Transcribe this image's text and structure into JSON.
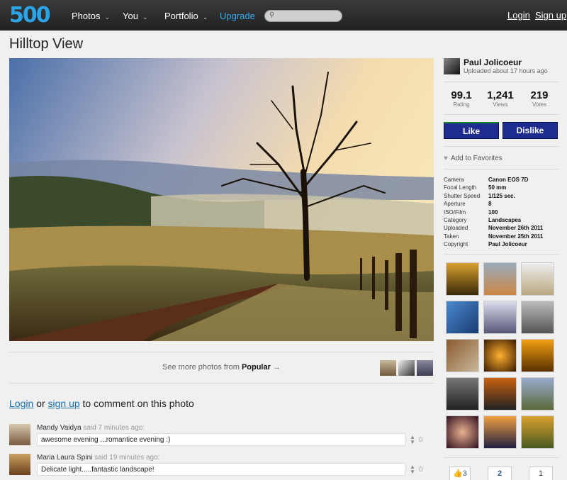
{
  "app": {
    "logo": "500"
  },
  "nav": {
    "photos": "Photos",
    "you": "You",
    "portfolio": "Portfolio",
    "upgrade": "Upgrade",
    "chevron": "⌄",
    "login": "Login",
    "signup": "Sign up"
  },
  "search": {
    "placeholder": "",
    "icon": "search-icon"
  },
  "photo": {
    "title": "Hilltop View"
  },
  "seemore": {
    "prefix": "See more photos from ",
    "category": "Popular",
    "arrow": "→"
  },
  "comment_prompt": {
    "login": "Login",
    "or": " or ",
    "signup": "sign up",
    "suffix": " to comment on this photo"
  },
  "comments": [
    {
      "author": "Mandy Vaidya",
      "when": " said 7 minutes ago:",
      "text": "awesome evening ...romantice evening :)",
      "votes": "0"
    },
    {
      "author": "Maria Laura Spini",
      "when": " said 19 minutes ago:",
      "text": "Delicate light.....fantastic landscape!",
      "votes": "0"
    }
  ],
  "owner": {
    "name": "Paul Jolicoeur",
    "uploaded": "Uploaded about 17 hours ago"
  },
  "stats": [
    {
      "value": "99.1",
      "label": "Rating"
    },
    {
      "value": "1,241",
      "label": "Views"
    },
    {
      "value": "219",
      "label": "Votes"
    }
  ],
  "actions": {
    "like": "Like",
    "dislike": "Dislike",
    "favorite": "Add to Favorites"
  },
  "specs": [
    {
      "label": "Camera",
      "value": "Canon EOS 7D"
    },
    {
      "label": "Focal Length",
      "value": "50 mm"
    },
    {
      "label": "Shutter Speed",
      "value": "1/125 sec."
    },
    {
      "label": "Aperture",
      "value": "8"
    },
    {
      "label": "ISO/Film",
      "value": "100"
    },
    {
      "label": "Category",
      "value": "Landscapes"
    },
    {
      "label": "Uploaded",
      "value": "November 26th 2011"
    },
    {
      "label": "Taken",
      "value": "November 25th 2011"
    },
    {
      "label": "Copyright",
      "value": "Paul Jolicoeur"
    }
  ],
  "share": {
    "fb": "3",
    "second": "2",
    "third": "1"
  },
  "colors": {
    "accent": "#2ba5e8",
    "button": "#1e2b8f",
    "link": "#1a6fae"
  }
}
